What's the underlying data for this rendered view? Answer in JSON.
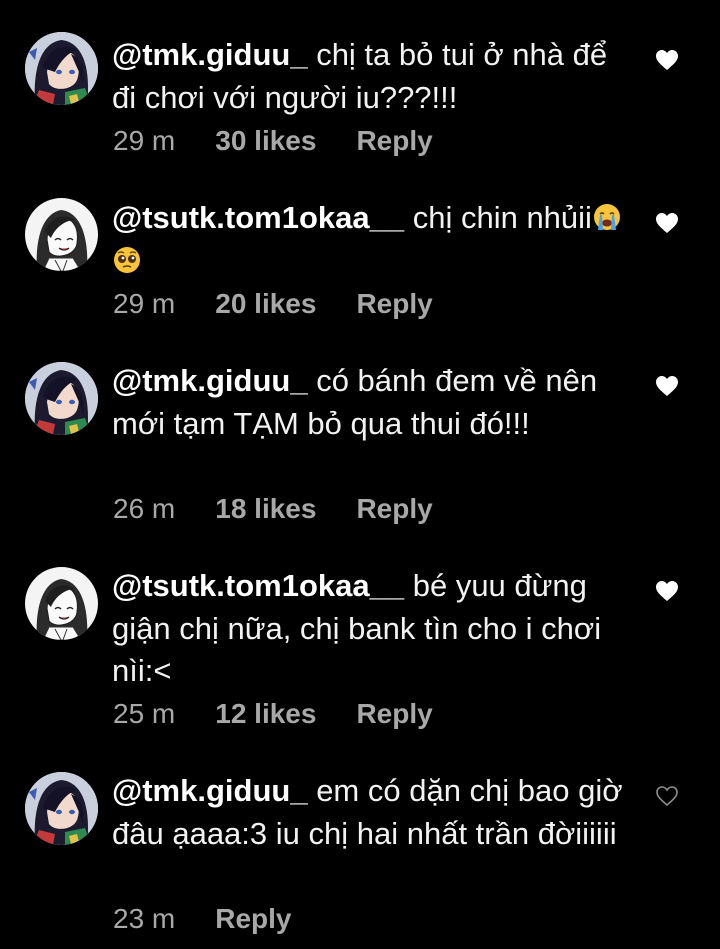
{
  "colors": {
    "background": "#000000",
    "text": "#f2f2f2",
    "meta": "#a8a8a8",
    "liked_heart": "#ffffff",
    "unliked_heart": "#8e8e8e"
  },
  "comments": [
    {
      "username": "@tmk.giduu_",
      "text": " chị ta bỏ tui ở nhà để đi chơi với người iu???!!!",
      "time": "29 m",
      "likes": "30 likes",
      "reply": "Reply",
      "liked": true,
      "avatar": "dark-haired-anime-avatar"
    },
    {
      "username": "@tsutk.tom1okaa__",
      "text": " chị chin nhủii",
      "emojis": [
        "loudly-crying-face",
        "pleading-face"
      ],
      "time": "29 m",
      "likes": "20 likes",
      "reply": "Reply",
      "liked": true,
      "avatar": "sketch-anime-avatar"
    },
    {
      "username": "@tmk.giduu_",
      "text": " có bánh đem về nên mới tạm TẠM bỏ qua thui đó!!!",
      "time": "26 m",
      "likes": "18 likes",
      "reply": "Reply",
      "liked": true,
      "avatar": "dark-haired-anime-avatar"
    },
    {
      "username": "@tsutk.tom1okaa__",
      "text": " bé yuu đừng giận chị nữa, chị bank tìn cho i chơi nìi:<",
      "time": "25 m",
      "likes": "12 likes",
      "reply": "Reply",
      "liked": true,
      "avatar": "sketch-anime-avatar"
    },
    {
      "username": "@tmk.giduu_",
      "text": " em có dặn chị bao giờ đâu ạaaa:3 iu chị hai nhất trần đờiiiiii",
      "time": "23 m",
      "reply": "Reply",
      "liked": false,
      "avatar": "dark-haired-anime-avatar"
    }
  ]
}
